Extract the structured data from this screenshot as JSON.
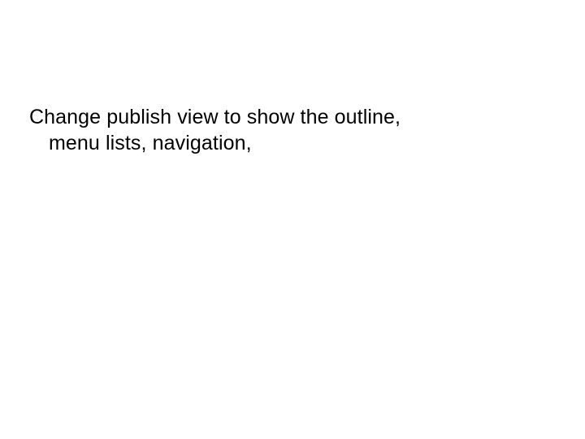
{
  "slide": {
    "body_line1": "Change publish view to show the outline,",
    "body_line2": "menu lists, navigation,"
  }
}
